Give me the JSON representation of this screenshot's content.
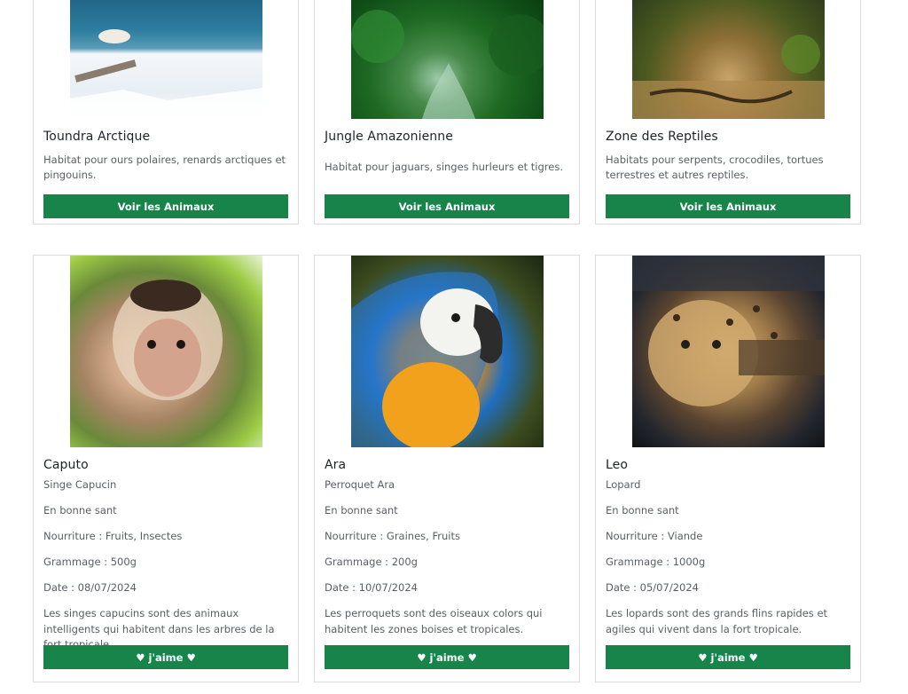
{
  "habitats": [
    {
      "title": "Toundra Arctique",
      "description": "Habitat pour ours polaires, renards arctiques et pingouins.",
      "button": "Voir les Animaux"
    },
    {
      "title": "Jungle Amazonienne",
      "description": "Habitat pour jaguars, singes hurleurs et tigres.",
      "button": "Voir les Animaux"
    },
    {
      "title": "Zone des Reptiles",
      "description": "Habitats pour serpents, crocodiles, tortues terrestres et autres reptiles.",
      "button": "Voir les Animaux"
    }
  ],
  "animals": [
    {
      "name": "Caputo",
      "species": "Singe Capucin",
      "health": "En bonne sant",
      "food": "Nourriture : Fruits, Insectes",
      "weight": "Grammage : 500g",
      "date": "Date : 08/07/2024",
      "description": "Les singes capucins sont des animaux intelligents qui habitent dans les arbres de la fort tropicale.",
      "like_button": "♥ j'aime ♥"
    },
    {
      "name": "Ara",
      "species": "Perroquet Ara",
      "health": "En bonne sant",
      "food": "Nourriture : Graines, Fruits",
      "weight": "Grammage : 200g",
      "date": "Date : 10/07/2024",
      "description": "Les perroquets sont des oiseaux colors qui habitent les zones boises et tropicales.",
      "like_button": "♥ j'aime ♥"
    },
    {
      "name": "Leo",
      "species": "Lopard",
      "health": "En bonne sant",
      "food": "Nourriture : Viande",
      "weight": "Grammage : 1000g",
      "date": "Date : 05/07/2024",
      "description": "Les lopards sont des grands flins rapides et agiles qui vivent dans la fort tropicale.",
      "like_button": "♥ j'aime ♥"
    }
  ],
  "colors": {
    "button": "#17844a",
    "card_border": "#dcdcdc",
    "text_muted": "#5a5f66"
  }
}
